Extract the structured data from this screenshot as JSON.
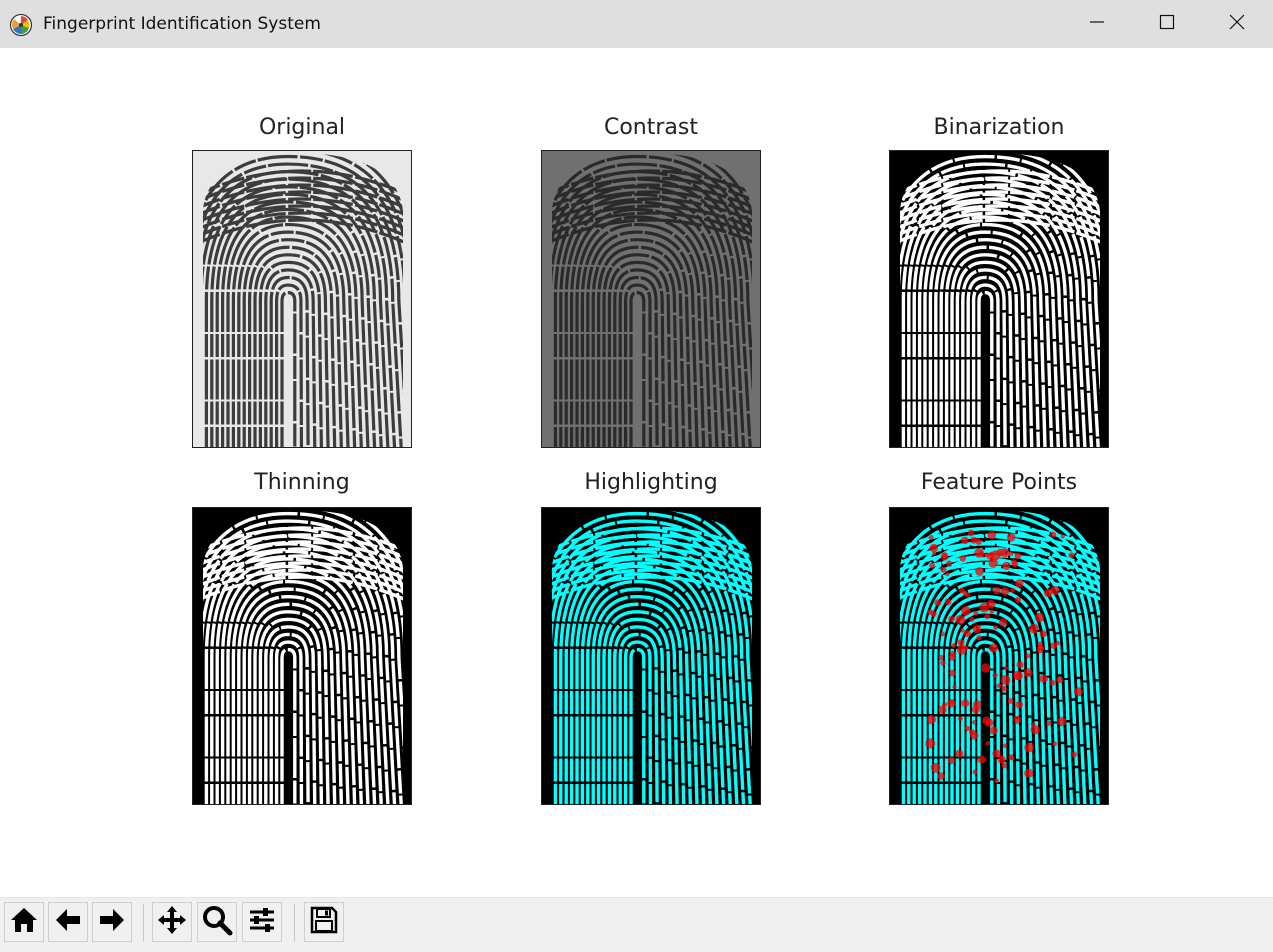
{
  "window": {
    "title": "Fingerprint Identification System",
    "app_icon": "matplotlib-logo-icon",
    "controls": [
      "minimize-icon",
      "maximize-icon",
      "close-icon"
    ]
  },
  "figure": {
    "panels": [
      {
        "title": "Original",
        "style": "grayscale-light"
      },
      {
        "title": "Contrast",
        "style": "grayscale-dark"
      },
      {
        "title": "Binarization",
        "style": "binary"
      },
      {
        "title": "Thinning",
        "style": "binary"
      },
      {
        "title": "Highlighting",
        "style": "cyan"
      },
      {
        "title": "Feature Points",
        "style": "cyan-with-red-points"
      }
    ]
  },
  "toolbar": {
    "buttons": [
      "home-icon",
      "back-icon",
      "forward-icon",
      "pan-icon",
      "zoom-icon",
      "configure-subplots-icon",
      "save-icon"
    ]
  },
  "colors": {
    "highlight_ridges": "#00ffff",
    "feature_points": "#ff0000"
  }
}
